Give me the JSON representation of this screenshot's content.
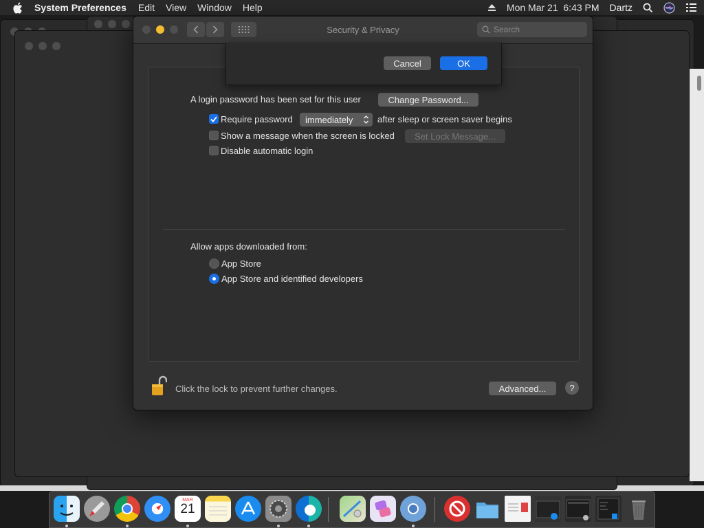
{
  "menubar": {
    "app_name": "System Preferences",
    "menus": [
      "Edit",
      "View",
      "Window",
      "Help"
    ],
    "datetime": "Mon Mar 21  6:43 PM",
    "user": "Dartz",
    "icons": [
      "apple-icon",
      "eject-icon",
      "spotlight-icon",
      "siri-icon",
      "control-center-icon"
    ]
  },
  "window": {
    "title": "Security & Privacy",
    "search_placeholder": "Search"
  },
  "sheet": {
    "cancel_label": "Cancel",
    "ok_label": "OK"
  },
  "general": {
    "password_set_text": "A login password has been set for this user",
    "change_password_label": "Change Password...",
    "require_password_label": "Require password",
    "require_password_checked": true,
    "require_password_delay": "immediately",
    "after_sleep_text": "after sleep or screen saver begins",
    "show_message_label": "Show a message when the screen is locked",
    "show_message_checked": false,
    "set_lock_message_label": "Set Lock Message...",
    "disable_auto_login_label": "Disable automatic login",
    "disable_auto_login_checked": false,
    "allow_apps_heading": "Allow apps downloaded from:",
    "options": [
      {
        "label": "App Store",
        "selected": false
      },
      {
        "label": "App Store and identified developers",
        "selected": true
      }
    ]
  },
  "footer": {
    "lock_text": "Click the lock to prevent further changes.",
    "advanced_label": "Advanced...",
    "help_label": "?"
  },
  "dock": {
    "calendar_month": "MAR",
    "calendar_day": "21",
    "apps": [
      "finder",
      "launchpad",
      "chrome",
      "safari",
      "calendar",
      "notes",
      "app-store",
      "system-preferences",
      "edge",
      "maps",
      "shortcuts",
      "chromium",
      "no-entry",
      "preview",
      "downloads",
      "document-preview",
      "window-preview-1",
      "window-preview-2",
      "window-preview-3",
      "trash"
    ]
  },
  "colors": {
    "accent": "#1a6ee6",
    "minimize": "#f4bc31"
  }
}
